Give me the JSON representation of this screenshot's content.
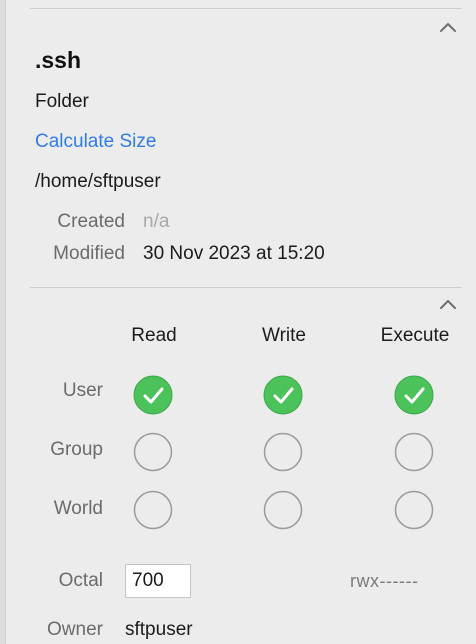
{
  "item": {
    "name": ".ssh",
    "kind": "Folder",
    "calculate_size_label": "Calculate Size",
    "path": "/home/sftpuser"
  },
  "meta": {
    "created_label": "Created",
    "created_value": "n/a",
    "modified_label": "Modified",
    "modified_value": "30 Nov 2023 at 15:20"
  },
  "permissions": {
    "columns": [
      "Read",
      "Write",
      "Execute"
    ],
    "rows": [
      {
        "label": "User",
        "checked": [
          true,
          true,
          true
        ]
      },
      {
        "label": "Group",
        "checked": [
          false,
          false,
          false
        ]
      },
      {
        "label": "World",
        "checked": [
          false,
          false,
          false
        ]
      }
    ],
    "octal_label": "Octal",
    "octal_value": "700",
    "symbolic": "rwx------",
    "owner_label": "Owner",
    "owner_value": "sftpuser"
  },
  "colors": {
    "accent_link": "#2f7ce6",
    "checked_fill": "#4cc35a",
    "unchecked_stroke": "#9a9a9a"
  },
  "icons": {
    "section_collapse": "chevron-up-icon",
    "checked": "checkmark-circle-icon",
    "unchecked": "empty-circle-icon"
  }
}
